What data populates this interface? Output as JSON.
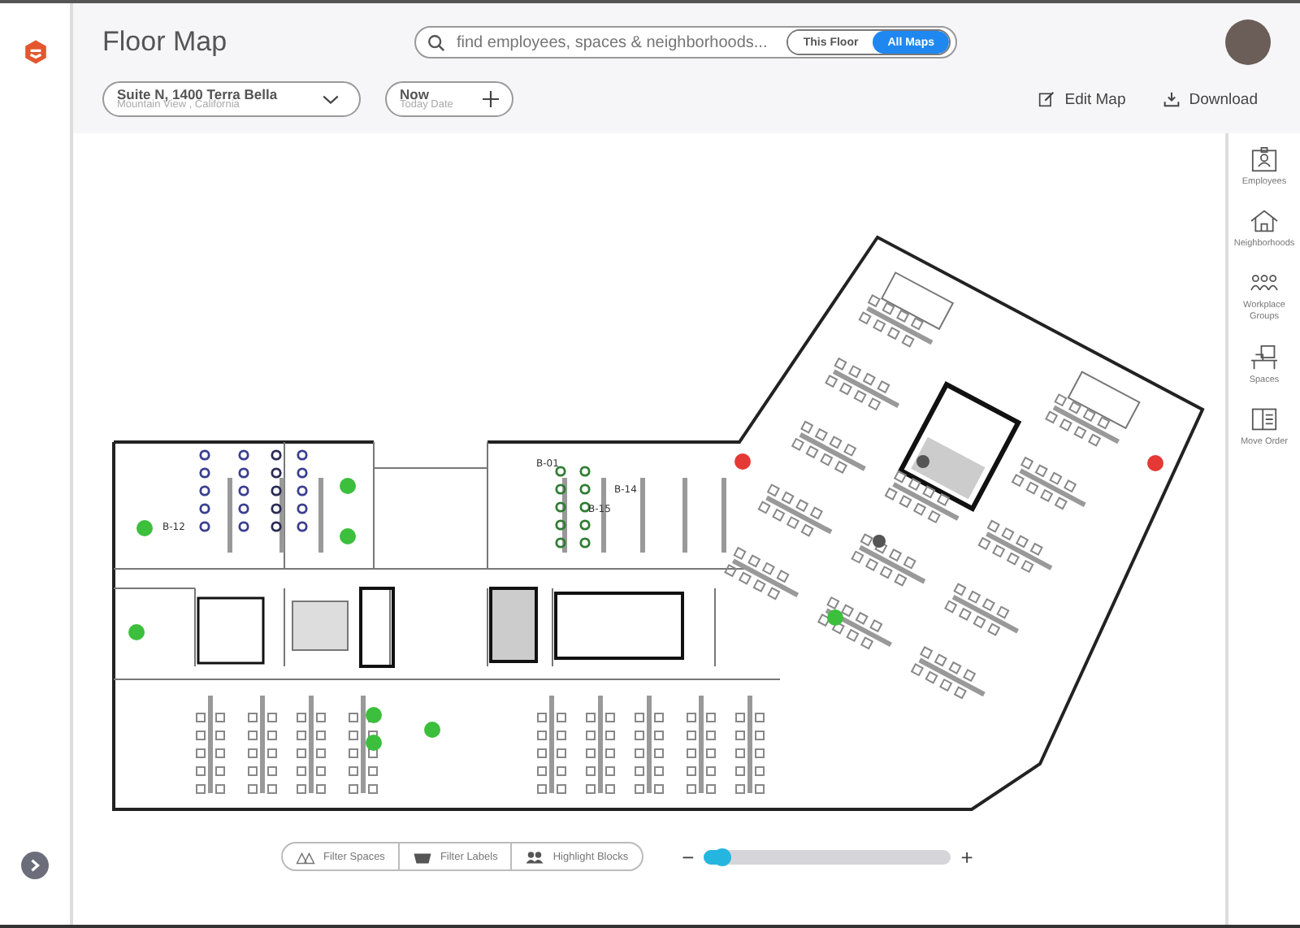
{
  "app": {
    "title": "Floor Map"
  },
  "search": {
    "placeholder": "find employees, spaces & neighborhoods...",
    "scopes": [
      {
        "label": "This Floor",
        "selected": false
      },
      {
        "label": "All Maps",
        "selected": true
      }
    ]
  },
  "location": {
    "name": "Suite N, 1400 Terra Bella",
    "address": "Mountain View , California"
  },
  "date": {
    "label": "Now",
    "sublabel": "Today Date"
  },
  "actions": [
    {
      "kind": "edit",
      "label": "Edit Map"
    },
    {
      "kind": "download",
      "label": "Download"
    }
  ],
  "side_panel": [
    {
      "kind": "employees",
      "label": "Employees"
    },
    {
      "kind": "neighborhoods",
      "label": "Neighborhoods"
    },
    {
      "kind": "groups",
      "label": "Workplace Groups"
    },
    {
      "kind": "spaces",
      "label": "Spaces"
    },
    {
      "kind": "move",
      "label": "Move Order"
    }
  ],
  "map_labels": [
    "B-01",
    "B-14",
    "B-15",
    "B-12"
  ],
  "filters": [
    {
      "kind": "spaces",
      "label": "Filter Spaces"
    },
    {
      "kind": "labels",
      "label": "Filter Labels"
    },
    {
      "kind": "blocks",
      "label": "Highlight Blocks"
    }
  ],
  "zoom": {
    "minus": "−",
    "plus": "+",
    "level": 0.08
  }
}
